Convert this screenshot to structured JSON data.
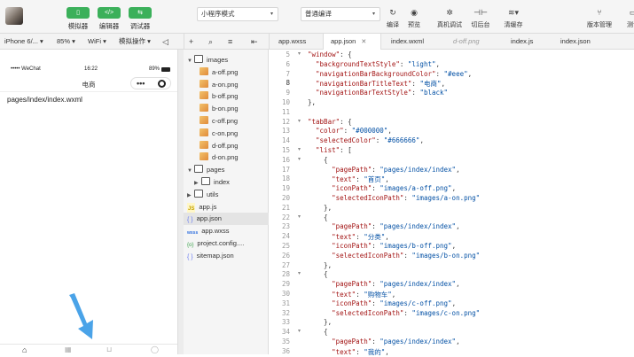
{
  "toolbar": {
    "buttons": [
      {
        "label": "模拟器",
        "icon": "phone-icon",
        "glyph": "▯"
      },
      {
        "label": "编辑器",
        "icon": "code-icon",
        "glyph": "</>"
      },
      {
        "label": "调试器",
        "icon": "debug-icon",
        "glyph": "⇆"
      }
    ],
    "mode_select": "小程序模式",
    "compile_select": "普通编译",
    "right_buttons": [
      {
        "label": "编译",
        "icon": "refresh-icon",
        "glyph": "↻"
      },
      {
        "label": "预览",
        "icon": "eye-icon",
        "glyph": "◉"
      },
      {
        "label": "真机调试",
        "icon": "bug-icon",
        "glyph": "✲"
      },
      {
        "label": "切后台",
        "icon": "switch-icon",
        "glyph": "⊣⊢"
      },
      {
        "label": "清缓存",
        "icon": "stack-icon",
        "glyph": "≋▾"
      },
      {
        "label": "版本管理",
        "icon": "branch-icon",
        "glyph": "⑂"
      },
      {
        "label": "测试",
        "icon": "test-icon",
        "glyph": "▭"
      }
    ]
  },
  "simbar": {
    "device": "iPhone 6/...",
    "zoom": "85%",
    "network": "WiFi",
    "sim_ops": "模拟操作"
  },
  "tabs": [
    {
      "label": "app.wxss",
      "state": "normal"
    },
    {
      "label": "app.json",
      "state": "active"
    },
    {
      "label": "index.wxml",
      "state": "normal"
    },
    {
      "label": "d-off.png",
      "state": "inactive"
    },
    {
      "label": "index.js",
      "state": "normal"
    },
    {
      "label": "index.json",
      "state": "normal"
    }
  ],
  "phone": {
    "carrier": "••••• WeChat",
    "time": "16:22",
    "battery": "89%",
    "title": "电商",
    "path": "pages/index/index.wxml"
  },
  "tree": [
    {
      "label": "images",
      "type": "folder-open",
      "indent": 0
    },
    {
      "label": "a-off.png",
      "type": "png",
      "indent": 1
    },
    {
      "label": "a-on.png",
      "type": "png",
      "indent": 1
    },
    {
      "label": "b-off.png",
      "type": "png",
      "indent": 1
    },
    {
      "label": "b-on.png",
      "type": "png",
      "indent": 1
    },
    {
      "label": "c-off.png",
      "type": "png",
      "indent": 1
    },
    {
      "label": "c-on.png",
      "type": "png",
      "indent": 1
    },
    {
      "label": "d-off.png",
      "type": "png",
      "indent": 1
    },
    {
      "label": "d-on.png",
      "type": "png",
      "indent": 1
    },
    {
      "label": "pages",
      "type": "folder-open",
      "indent": 0
    },
    {
      "label": "index",
      "type": "folder-closed",
      "indent": 1
    },
    {
      "label": "utils",
      "type": "folder-closed",
      "indent": 0
    },
    {
      "label": "app.js",
      "type": "js",
      "indent": 0
    },
    {
      "label": "app.json",
      "type": "json",
      "indent": 0,
      "selected": true
    },
    {
      "label": "app.wxss",
      "type": "wxss",
      "indent": 0
    },
    {
      "label": "project.config....",
      "type": "config",
      "indent": 0
    },
    {
      "label": "sitemap.json",
      "type": "json",
      "indent": 0
    }
  ],
  "code_lines": [
    {
      "n": "5",
      "text": "\"window\": {"
    },
    {
      "n": "6",
      "text": "  \"backgroundTextStyle\": \"light\","
    },
    {
      "n": "7",
      "text": "  \"navigationBarBackgroundColor\": \"#eee\","
    },
    {
      "n": "8",
      "text": "  \"navigationBarTitleText\": \"电商\","
    },
    {
      "n": "9",
      "text": "  \"navigationBarTextStyle\": \"black\""
    },
    {
      "n": "10",
      "text": "},"
    },
    {
      "n": "11",
      "text": ""
    },
    {
      "n": "12",
      "text": "\"tabBar\": {"
    },
    {
      "n": "13",
      "text": "  \"color\": \"#000000\","
    },
    {
      "n": "14",
      "text": "  \"selectedColor\": \"#666666\","
    },
    {
      "n": "15",
      "text": "  \"list\": ["
    },
    {
      "n": "16",
      "text": "    {"
    },
    {
      "n": "17",
      "text": "      \"pagePath\": \"pages/index/index\","
    },
    {
      "n": "18",
      "text": "      \"text\": \"首页\","
    },
    {
      "n": "19",
      "text": "      \"iconPath\": \"images/a-off.png\","
    },
    {
      "n": "20",
      "text": "      \"selectedIconPath\": \"images/a-on.png\""
    },
    {
      "n": "21",
      "text": "    },"
    },
    {
      "n": "22",
      "text": "    {"
    },
    {
      "n": "23",
      "text": "      \"pagePath\": \"pages/index/index\","
    },
    {
      "n": "24",
      "text": "      \"text\": \"分类\","
    },
    {
      "n": "25",
      "text": "      \"iconPath\": \"images/b-off.png\","
    },
    {
      "n": "26",
      "text": "      \"selectedIconPath\": \"images/b-on.png\""
    },
    {
      "n": "27",
      "text": "    },"
    },
    {
      "n": "28",
      "text": "    {"
    },
    {
      "n": "29",
      "text": "      \"pagePath\": \"pages/index/index\","
    },
    {
      "n": "30",
      "text": "      \"text\": \"购物车\","
    },
    {
      "n": "31",
      "text": "      \"iconPath\": \"images/c-off.png\","
    },
    {
      "n": "32",
      "text": "      \"selectedIconPath\": \"images/c-on.png\""
    },
    {
      "n": "33",
      "text": "    },"
    },
    {
      "n": "34",
      "text": "    {"
    },
    {
      "n": "35",
      "text": "      \"pagePath\": \"pages/index/index\","
    },
    {
      "n": "36",
      "text": "      \"text\": \"我的\","
    }
  ],
  "colors": {
    "accent_green": "#3bb05a",
    "arrow_blue": "#4aa3e8",
    "string_blue": "#0451a5",
    "key_red": "#a31515"
  }
}
